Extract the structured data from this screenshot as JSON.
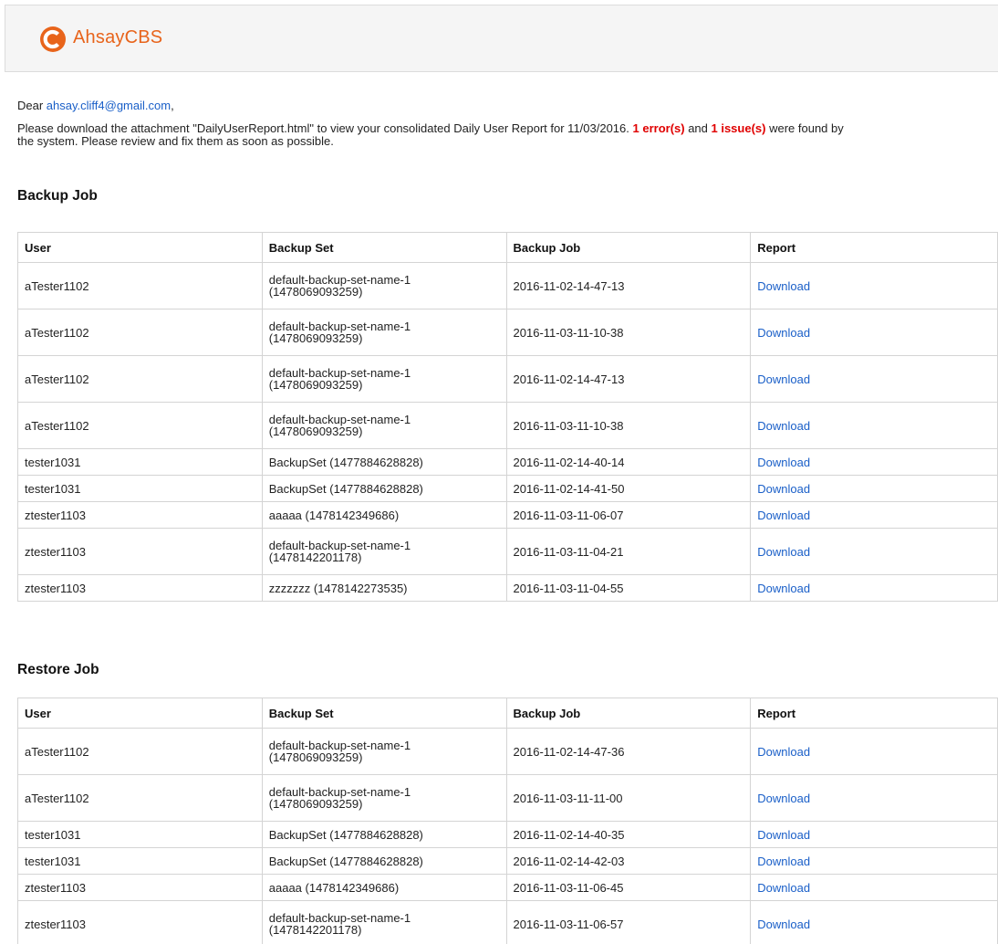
{
  "brand": {
    "name": "AhsayCBS",
    "accent": "#e8641b"
  },
  "greeting": {
    "prefix": "Dear ",
    "email": "ahsay.cliff4@gmail.com",
    "suffix": ","
  },
  "message": {
    "part1": "Please download the attachment \"DailyUserReport.html\" to view your consolidated Daily User Report for 11/03/2016. ",
    "errors": "1 error(s)",
    "and": " and ",
    "issues": "1 issue(s)",
    "part2": " were found by",
    "line2": "the system. Please review and fix them as soon as possible."
  },
  "backup_section": {
    "title": "Backup Job",
    "headers": [
      "User",
      "Backup Set",
      "Backup Job",
      "Report"
    ],
    "rows": [
      {
        "user": "aTester1102",
        "set_line1": "default-backup-set-name-1",
        "set_line2": "(1478069093259)",
        "job": "2016-11-02-14-47-13",
        "report": "Download"
      },
      {
        "user": "aTester1102",
        "set_line1": "default-backup-set-name-1",
        "set_line2": "(1478069093259)",
        "job": "2016-11-03-11-10-38",
        "report": "Download"
      },
      {
        "user": "aTester1102",
        "set_line1": "default-backup-set-name-1",
        "set_line2": "(1478069093259)",
        "job": "2016-11-02-14-47-13",
        "report": "Download"
      },
      {
        "user": "aTester1102",
        "set_line1": "default-backup-set-name-1",
        "set_line2": "(1478069093259)",
        "job": "2016-11-03-11-10-38",
        "report": "Download"
      },
      {
        "user": "tester1031",
        "set_line1": "BackupSet (1477884628828)",
        "set_line2": "",
        "job": "2016-11-02-14-40-14",
        "report": "Download"
      },
      {
        "user": "tester1031",
        "set_line1": "BackupSet (1477884628828)",
        "set_line2": "",
        "job": "2016-11-02-14-41-50",
        "report": "Download"
      },
      {
        "user": "ztester1103",
        "set_line1": "aaaaa (1478142349686)",
        "set_line2": "",
        "job": "2016-11-03-11-06-07",
        "report": "Download"
      },
      {
        "user": "ztester1103",
        "set_line1": "default-backup-set-name-1",
        "set_line2": "(1478142201178)",
        "job": "2016-11-03-11-04-21",
        "report": "Download"
      },
      {
        "user": "ztester1103",
        "set_line1": "zzzzzzz (1478142273535)",
        "set_line2": "",
        "job": "2016-11-03-11-04-55",
        "report": "Download"
      }
    ]
  },
  "restore_section": {
    "title": "Restore Job",
    "headers": [
      "User",
      "Backup Set",
      "Backup Job",
      "Report"
    ],
    "rows": [
      {
        "user": "aTester1102",
        "set_line1": "default-backup-set-name-1",
        "set_line2": "(1478069093259)",
        "job": "2016-11-02-14-47-36",
        "report": "Download"
      },
      {
        "user": "aTester1102",
        "set_line1": "default-backup-set-name-1",
        "set_line2": "(1478069093259)",
        "job": "2016-11-03-11-11-00",
        "report": "Download"
      },
      {
        "user": "tester1031",
        "set_line1": "BackupSet (1477884628828)",
        "set_line2": "",
        "job": "2016-11-02-14-40-35",
        "report": "Download"
      },
      {
        "user": "tester1031",
        "set_line1": "BackupSet (1477884628828)",
        "set_line2": "",
        "job": "2016-11-02-14-42-03",
        "report": "Download"
      },
      {
        "user": "ztester1103",
        "set_line1": "aaaaa (1478142349686)",
        "set_line2": "",
        "job": "2016-11-03-11-06-45",
        "report": "Download"
      },
      {
        "user": "ztester1103",
        "set_line1": "default-backup-set-name-1",
        "set_line2": "(1478142201178)",
        "job": "2016-11-03-11-06-57",
        "report": "Download"
      }
    ]
  }
}
